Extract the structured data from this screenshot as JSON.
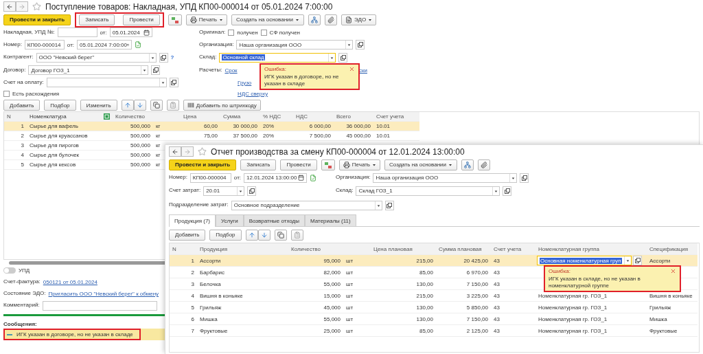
{
  "back_window": {
    "title": "Поступление товаров: Накладная, УПД КП00-000014 от 05.01.2024 7:00:00",
    "toolbar": [
      {
        "kind": "primary",
        "label": "Провести и закрыть",
        "highlight": false
      },
      {
        "kind": "plain",
        "label": "Записать",
        "highlight": true
      },
      {
        "kind": "plain",
        "label": "Провести",
        "highlight": true
      },
      {
        "kind": "dtkt",
        "highlight": false
      },
      {
        "kind": "print",
        "label": "Печать",
        "highlight": false
      },
      {
        "kind": "dropdown",
        "label": "Создать на основании",
        "highlight": false
      },
      {
        "kind": "structure",
        "highlight": false
      },
      {
        "kind": "attach",
        "highlight": false
      },
      {
        "kind": "edo",
        "label": "ЭДО",
        "highlight": false
      }
    ],
    "invoice": {
      "label": "Накладная, УПД №:",
      "date_label": "от:",
      "date": "05.01.2024"
    },
    "number": {
      "label": "Номер:",
      "value": "КП00-000014",
      "date_label": "от:",
      "date": "05.01.2024  7:00:00"
    },
    "counterparty": {
      "label": "Контрагент:",
      "value": "ООО \"Невский берег\"",
      "help": "?"
    },
    "contract": {
      "label": "Договор:",
      "value": "Договор ГОЗ_1"
    },
    "payment_account": {
      "label": "Счет на оплату:"
    },
    "discrepancy": {
      "label": "Есть расхождения",
      "checked": false
    },
    "original": {
      "label": "Оригинал:",
      "options": [
        {
          "label": "получен",
          "checked": false
        },
        {
          "label": "СФ получен",
          "checked": false
        }
      ]
    },
    "organization": {
      "label": "Организация:",
      "value": "Наша организация ООО"
    },
    "warehouse": {
      "label": "Склад:",
      "value": "Основной склад",
      "focused": true
    },
    "settlements": {
      "label": "Расчеты:",
      "link": "Срок",
      "link_tail": "ски",
      "second_link": "Грузо"
    },
    "vat_link": "НДС сверху",
    "table_toolbar": [
      {
        "kind": "plain",
        "label": "Добавить"
      },
      {
        "kind": "plain",
        "label": "Подбор"
      },
      {
        "kind": "plain",
        "label": "Изменить"
      },
      {
        "kind": "arrows"
      },
      {
        "kind": "copy"
      },
      {
        "kind": "paste"
      },
      {
        "kind": "barcode",
        "label": "Добавить по штрихкоду"
      }
    ],
    "table": {
      "columns": [
        {
          "kind": "number",
          "label": "N"
        },
        {
          "kind": "with_icon",
          "label": "Номенклатура"
        },
        {
          "kind": "with_unit",
          "label": "Количество"
        },
        {
          "kind": "number",
          "label": "Цена"
        },
        {
          "kind": "number",
          "label": "Сумма"
        },
        {
          "kind": "text",
          "label": "% НДС"
        },
        {
          "kind": "number",
          "label": "НДС"
        },
        {
          "kind": "number",
          "label": "Всего"
        },
        {
          "kind": "text",
          "label": "Счет учета"
        }
      ],
      "rows": [
        {
          "selected": true,
          "unit": "кг",
          "cells": [
            "1",
            "Сырье для вафель",
            "500,000",
            "60,00",
            "30 000,00",
            "20%",
            "6 000,00",
            "36 000,00",
            "10.01"
          ]
        },
        {
          "selected": false,
          "unit": "кг",
          "cells": [
            "2",
            "Сырье для круассанов",
            "500,000",
            "75,00",
            "37 500,00",
            "20%",
            "7 500,00",
            "45 000,00",
            "10.01"
          ]
        },
        {
          "selected": false,
          "unit": "кг",
          "cells": [
            "3",
            "Сырье для пирогов",
            "500,000"
          ]
        },
        {
          "selected": false,
          "unit": "кг",
          "cells": [
            "4",
            "Сырье для булочек",
            "500,000"
          ]
        },
        {
          "selected": false,
          "unit": "кг",
          "cells": [
            "5",
            "Сырье для кексов",
            "500,000"
          ]
        }
      ]
    },
    "upd_toggle": {
      "label": "УПД",
      "on": false
    },
    "invoice_link": {
      "label": "Счет-фактура:",
      "link": "050121 от 05.01.2024"
    },
    "edo_state": {
      "label": "Состояние ЭДО:",
      "link": "Пригласить ООО \"Невский берег\" к обмену"
    },
    "comment": {
      "label": "Комментарий:"
    },
    "messages": {
      "title": "Сообщения:",
      "items": [
        {
          "text": "ИГК указан в договоре, но не указан в складе",
          "highlight": true
        }
      ]
    },
    "error_popup": {
      "title": "Ошибка:",
      "text": "ИГК указан в договоре, но не указан в складе"
    }
  },
  "front_window": {
    "title": "Отчет производства за смену КП00-000004 от 12.01.2024 13:00:00",
    "toolbar": [
      {
        "kind": "primary",
        "label": "Провести и закрыть"
      },
      {
        "kind": "plain",
        "label": "Записать"
      },
      {
        "kind": "plain",
        "label": "Провести"
      },
      {
        "kind": "dtkt"
      },
      {
        "kind": "print",
        "label": "Печать"
      },
      {
        "kind": "dropdown",
        "label": "Создать на основании"
      },
      {
        "kind": "structure"
      },
      {
        "kind": "attach"
      }
    ],
    "number": {
      "label": "Номер:",
      "value": "КП00-000004",
      "date_label": "от:",
      "date": "12.01.2024 13:00:00"
    },
    "organization": {
      "label": "Организация:",
      "value": "Наша организация ООО"
    },
    "cost_account": {
      "label": "Счет затрат:",
      "value": "20.01"
    },
    "warehouse": {
      "label": "Склад:",
      "value": "Склад ГОЗ_1"
    },
    "department": {
      "label": "Подразделение затрат:",
      "value": "Основное подразделение"
    },
    "tabs": [
      {
        "label": "Продукция (7)",
        "selected": true
      },
      {
        "label": "Услуги",
        "selected": false
      },
      {
        "label": "Возвратные отходы",
        "selected": false
      },
      {
        "label": "Материалы (11)",
        "selected": false
      }
    ],
    "table_toolbar": [
      {
        "kind": "plain",
        "label": "Добавить"
      },
      {
        "kind": "plain",
        "label": "Подбор"
      },
      {
        "kind": "arrows"
      },
      {
        "kind": "copy"
      },
      {
        "kind": "paste"
      }
    ],
    "table": {
      "columns": [
        {
          "kind": "number",
          "label": "N"
        },
        {
          "kind": "text",
          "label": "Продукция"
        },
        {
          "kind": "with_unit",
          "label": "Количество"
        },
        {
          "kind": "number",
          "label": "Цена плановая"
        },
        {
          "kind": "number",
          "label": "Сумма плановая"
        },
        {
          "kind": "text",
          "label": "Счет учета"
        },
        {
          "kind": "text",
          "label": "Номенклатурная группа"
        },
        {
          "kind": "text",
          "label": "Спецификация"
        }
      ],
      "rows": [
        {
          "selected": true,
          "editing": true,
          "unit": "шт",
          "cells": [
            "1",
            "Ассорти",
            "95,000",
            "215,00",
            "20 425,00",
            "43",
            "Основная номенклатурная груп",
            "Ассорти"
          ]
        },
        {
          "selected": false,
          "editing": false,
          "unit": "шт",
          "cells": [
            "2",
            "Барбарис",
            "82,000",
            "85,00",
            "6 970,00",
            "43"
          ]
        },
        {
          "selected": false,
          "editing": false,
          "unit": "шт",
          "cells": [
            "3",
            "Белочка",
            "55,000",
            "130,00",
            "7 150,00",
            "43"
          ]
        },
        {
          "selected": false,
          "editing": false,
          "unit": "шт",
          "cells": [
            "4",
            "Вишня в коньяке",
            "15,000",
            "215,00",
            "3 225,00",
            "43",
            "Номенклатурная гр. ГОЗ_1",
            "Вишня в коньяке"
          ]
        },
        {
          "selected": false,
          "editing": false,
          "unit": "шт",
          "cells": [
            "5",
            "Грильяж",
            "45,000",
            "130,00",
            "5 850,00",
            "43",
            "Номенклатурная гр. ГОЗ_1",
            "Грильяж"
          ]
        },
        {
          "selected": false,
          "editing": false,
          "unit": "шт",
          "cells": [
            "6",
            "Мишка",
            "55,000",
            "130,00",
            "7 150,00",
            "43",
            "Номенклатурная гр. ГОЗ_1",
            "Мишка"
          ]
        },
        {
          "selected": false,
          "editing": false,
          "unit": "шт",
          "cells": [
            "7",
            "Фруктовые",
            "25,000",
            "85,00",
            "2 125,00",
            "43",
            "Номенклатурная гр. ГОЗ_1",
            "Фруктовые"
          ]
        }
      ]
    },
    "error_popup": {
      "title": "Ошибка:",
      "text": "ИГК указан в складе, но не указан в номенклатурной группе"
    }
  }
}
